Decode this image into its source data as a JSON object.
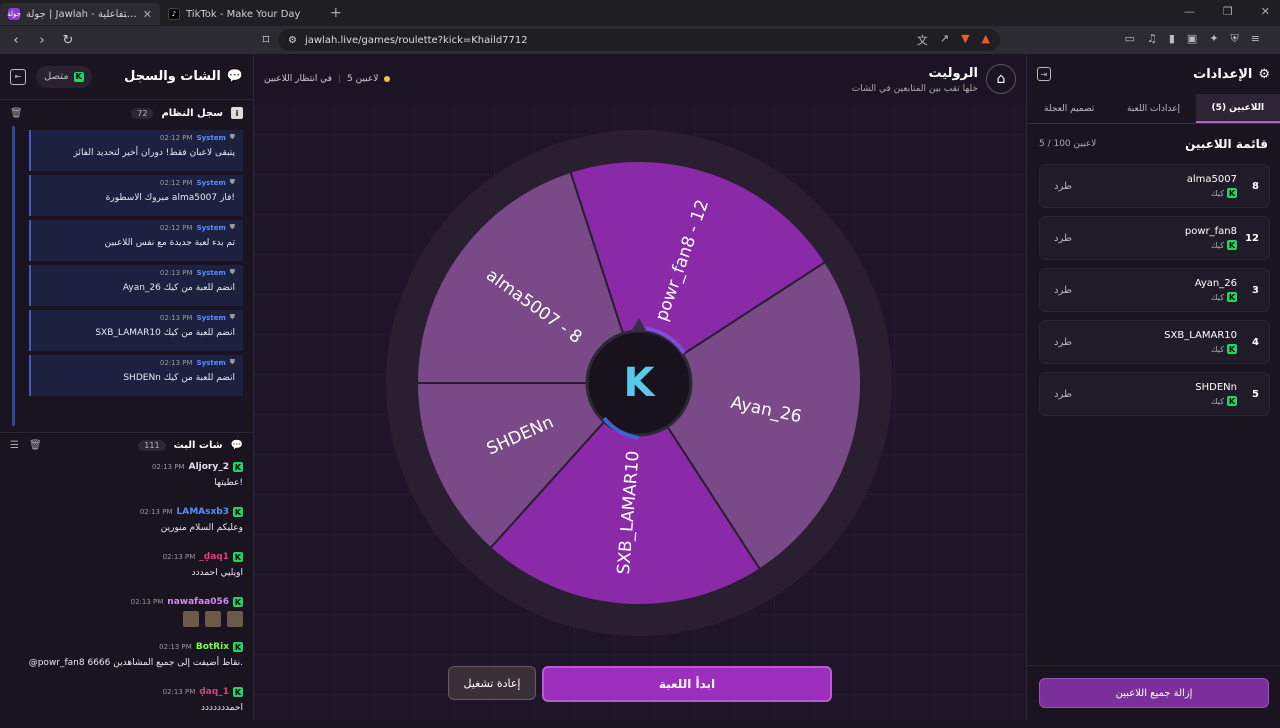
{
  "browser": {
    "tabs": [
      {
        "title": "جولة | Jawlah - منصة الألعاب التفاعلية",
        "favicon": "جولة"
      },
      {
        "title": "TikTok - Make Your Day",
        "favicon": "♪"
      }
    ],
    "url": "jawlah.live/games/roulette?kick=Khaild7712"
  },
  "chat": {
    "title": "الشات والسجل",
    "status": "متصل",
    "system_log": {
      "title": "سجل النظام",
      "count": "72",
      "messages": [
        {
          "who": "System",
          "time": "02:12 PM",
          "text": "يتبقى لاعبان فقط! دوران أخير لتحديد الفائز"
        },
        {
          "who": "System",
          "time": "02:12 PM",
          "text": "مبروك الاسطورة alma5007 فاز!"
        },
        {
          "who": "System",
          "time": "02:12 PM",
          "text": "تم بدء لعبة جديدة مع نفس اللاعبين"
        },
        {
          "who": "System",
          "time": "02:13 PM",
          "text": "Ayan_26 انضم للعبة من كيك"
        },
        {
          "who": "System",
          "time": "02:13 PM",
          "text": "SXB_LAMAR10 انضم للعبة من كيك"
        },
        {
          "who": "System",
          "time": "02:13 PM",
          "text": "SHDENn انضم للعبة من كيك"
        }
      ]
    },
    "stream": {
      "title": "شات البث",
      "count": "111",
      "messages": [
        {
          "user": "Aljory_2",
          "color": "#e8e0ee",
          "time": "02:13 PM",
          "text": "عطيتها!"
        },
        {
          "user": "LAMAsxb3",
          "color": "#5b8cff",
          "time": "02:13 PM",
          "text": "وعليكم السلام منورين"
        },
        {
          "user": "_ḍaq1",
          "color": "#e0407a",
          "time": "02:13 PM",
          "text": "اويليي احمددد"
        },
        {
          "user": "nawafaa056",
          "color": "#d28cf0",
          "time": "02:13 PM",
          "text": "",
          "emotes": 3
        },
        {
          "user": "BotRix",
          "color": "#7cff4a",
          "time": "02:13 PM",
          "text": "@powr_fan8 6666 نقاط أضيفت إلى جميع المشاهدين."
        },
        {
          "user": "ḍaq_1",
          "color": "#e0407a",
          "time": "02:13 PM",
          "text": "احمددددددد"
        }
      ]
    }
  },
  "game": {
    "title": "الروليت",
    "subtitle": "خلها تقب بين المتابعين في الشات",
    "players_count": "5 لاعبين",
    "state": "في انتظار اللاعبين",
    "start_label": "ابدأ اللعبة",
    "restart_label": "إعادة تشغيل",
    "logo": "K",
    "wheel": {
      "segments": [
        {
          "label": "powr_fan8 - 12",
          "color": "#8a2aa8"
        },
        {
          "label": "Ayan_26",
          "color": "#7a4a88"
        },
        {
          "label": "SXB_LAMAR10",
          "color": "#8a2aa8"
        },
        {
          "label": "SHDENn",
          "color": "#7a4a88"
        },
        {
          "label": "alma5007 - 8",
          "color": "#7a4a88"
        }
      ]
    }
  },
  "settings": {
    "title": "الإعدادات",
    "tabs": [
      "اللاعبين (5)",
      "إعدادات اللعبة",
      "تصميم العجلة"
    ],
    "players_title": "قائمة اللاعبين",
    "players_capacity": "5 / 100 لاعبين",
    "kick_label": "طرد",
    "platform": "كيك",
    "players": [
      {
        "name": "alma5007",
        "num": "8"
      },
      {
        "name": "powr_fan8",
        "num": "12"
      },
      {
        "name": "Ayan_26",
        "num": "3"
      },
      {
        "name": "SXB_LAMAR10",
        "num": "4"
      },
      {
        "name": "SHDENn",
        "num": "5"
      }
    ],
    "remove_all_label": "إزالة جميع اللاعبين"
  }
}
